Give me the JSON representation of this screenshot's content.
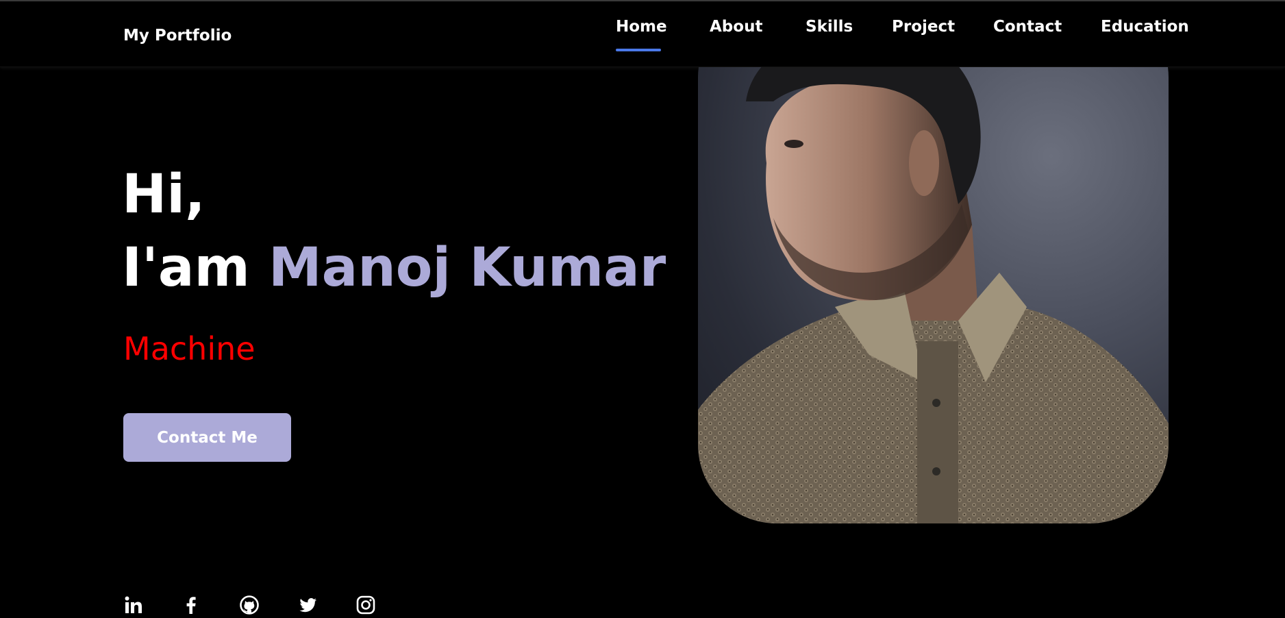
{
  "colors": {
    "accent": "#acaad8",
    "role": "#ff0000",
    "nav_underline": "#4a78e8",
    "background": "#000000"
  },
  "nav": {
    "brand": "My Portfolio",
    "items": [
      {
        "label": "Home",
        "active": true
      },
      {
        "label": "About"
      },
      {
        "label": "Skills"
      },
      {
        "label": "Project"
      },
      {
        "label": "Contact"
      },
      {
        "label": "Education"
      }
    ]
  },
  "hero": {
    "greeting": "Hi,",
    "intro": "I'am",
    "name": "Manoj Kumar",
    "role": "Machine",
    "cta_label": "Contact Me"
  },
  "socials": [
    {
      "icon": "linkedin-icon"
    },
    {
      "icon": "facebook-icon"
    },
    {
      "icon": "github-icon"
    },
    {
      "icon": "twitter-icon"
    },
    {
      "icon": "instagram-icon"
    }
  ]
}
